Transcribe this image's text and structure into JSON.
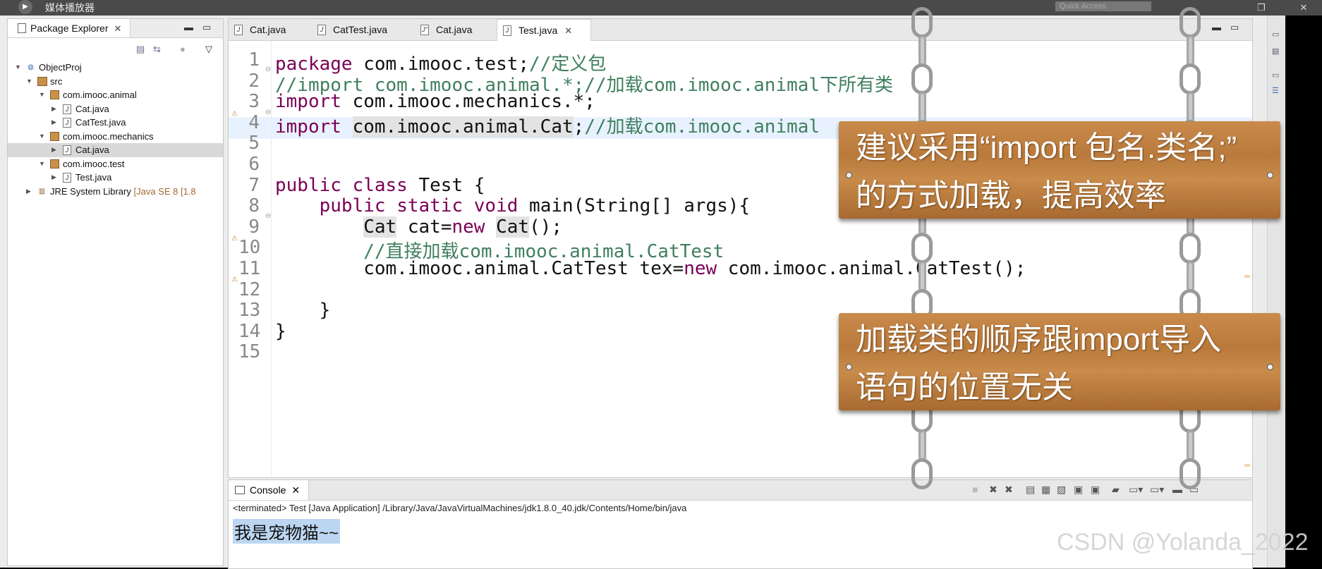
{
  "titlebar": {
    "app": "媒体播放器",
    "quick_access": "Quick Access",
    "play": "▶",
    "restore": "❐",
    "close": "✕"
  },
  "package_explorer": {
    "title": "Package Explorer",
    "close": "✕",
    "minimize": "▬",
    "maximize": "▭",
    "tree": [
      {
        "label": "ObjectProj"
      },
      {
        "label": "src"
      },
      {
        "label": "com.imooc.animal"
      },
      {
        "label": "Cat.java"
      },
      {
        "label": "CatTest.java"
      },
      {
        "label": "com.imooc.mechanics"
      },
      {
        "label": "Cat.java"
      },
      {
        "label": "com.imooc.test"
      },
      {
        "label": "Test.java"
      },
      {
        "label": "JRE System Library",
        "suffix": "[Java SE 8 [1.8"
      }
    ]
  },
  "editor": {
    "tabs": [
      {
        "label": "Cat.java"
      },
      {
        "label": "CatTest.java"
      },
      {
        "label": "Cat.java"
      },
      {
        "label": "Test.java",
        "close": "✕"
      }
    ],
    "lines": [
      {
        "n": "1",
        "parts": [
          [
            "kw",
            "package"
          ],
          [
            "",
            "com.imooc.test;"
          ],
          [
            "cm",
            "//定义包"
          ]
        ]
      },
      {
        "n": "2",
        "parts": [
          [
            "cm",
            "//import com.imooc.animal.*;//加载com.imooc.animal下所有类"
          ]
        ]
      },
      {
        "n": "3",
        "parts": [
          [
            "kw",
            "import"
          ],
          [
            "",
            " com.imooc.mechanics.*;"
          ]
        ]
      },
      {
        "n": "4",
        "parts": [
          [
            "kw",
            "import"
          ],
          [
            "",
            " "
          ],
          [
            "hl",
            "com.imooc.animal.Cat"
          ],
          [
            "",
            ";"
          ],
          [
            "cm",
            "//加载com.imooc.animal"
          ]
        ]
      },
      {
        "n": "5",
        "parts": []
      },
      {
        "n": "6",
        "parts": []
      },
      {
        "n": "7",
        "parts": [
          [
            "kw",
            "public class"
          ],
          [
            "",
            " Test {"
          ]
        ]
      },
      {
        "n": "8",
        "parts": [
          [
            "",
            "    "
          ],
          [
            "kw",
            "public static void"
          ],
          [
            "",
            " main(String[] args){"
          ]
        ]
      },
      {
        "n": "9",
        "parts": [
          [
            "",
            "        "
          ],
          [
            "hl",
            "Cat"
          ],
          [
            "",
            " cat="
          ],
          [
            "kw",
            "new"
          ],
          [
            "",
            " "
          ],
          [
            "hl",
            "Cat"
          ],
          [
            "",
            "();"
          ]
        ]
      },
      {
        "n": "10",
        "parts": [
          [
            "",
            "        "
          ],
          [
            "cm",
            "//直接加载com.imooc.animal.CatTest"
          ]
        ]
      },
      {
        "n": "11",
        "parts": [
          [
            "",
            "        com.imooc.animal.CatTest tex="
          ],
          [
            "kw",
            "new"
          ],
          [
            "",
            " com.imooc.animal.CatTest();"
          ]
        ]
      },
      {
        "n": "12",
        "parts": []
      },
      {
        "n": "13",
        "parts": [
          [
            "",
            "    }"
          ]
        ]
      },
      {
        "n": "14",
        "parts": [
          [
            "",
            "}"
          ]
        ]
      },
      {
        "n": "15",
        "parts": []
      }
    ]
  },
  "console": {
    "title": "Console",
    "close": "✕",
    "status": "<terminated> Test [Java Application] /Library/Java/JavaVirtualMachines/jdk1.8.0_40.jdk/Contents/Home/bin/java",
    "output": "我是宠物猫~~"
  },
  "overlays": {
    "board1": [
      "建议采用“import 包名.类名;”",
      "的方式加载，提高效率"
    ],
    "board2": [
      "加载类的顺序跟import导入",
      "语句的位置无关"
    ]
  },
  "watermark": "CSDN @Yolanda_2022",
  "colors": {
    "keyword": "#7a0055",
    "comment": "#3f7f5f",
    "wood": "#b97a3c",
    "selection": "#bcd6f2"
  }
}
